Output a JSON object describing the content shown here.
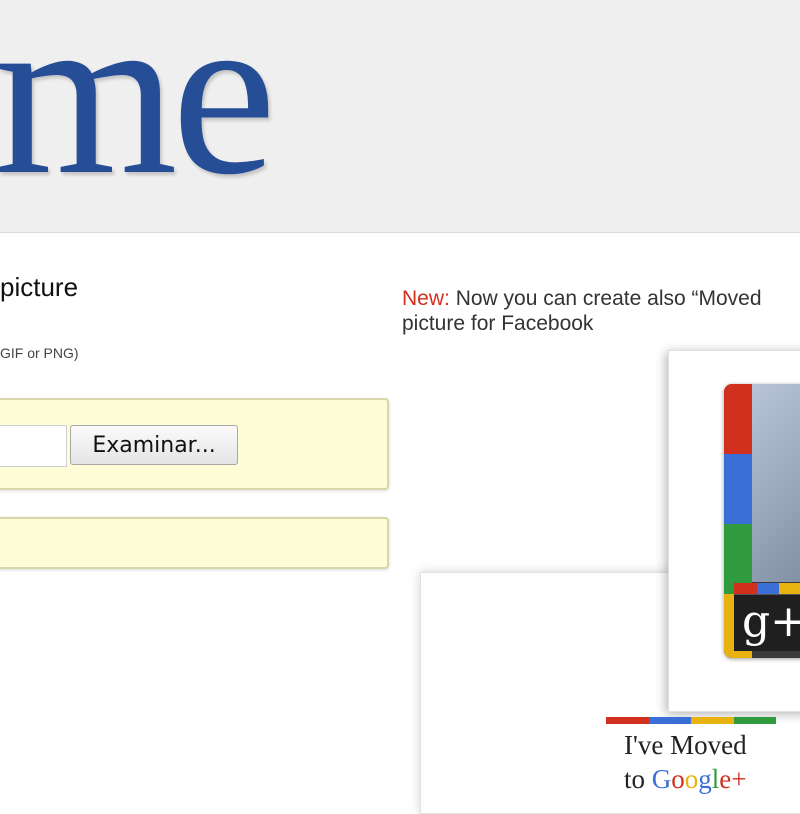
{
  "header": {
    "logo_text": "me"
  },
  "upload": {
    "heading": "picture",
    "format_hint": "GIF or PNG)",
    "browse_label": "Examinar..."
  },
  "news": {
    "label": "New:",
    "line1": "Now you can create also “Moved",
    "line2": "picture for Facebook"
  },
  "preview": {
    "moved_line1": "I've Moved",
    "moved_line2_prefix": "to ",
    "google_letters": [
      "G",
      "o",
      "o",
      "g",
      "l",
      "e"
    ],
    "google_plus": "+",
    "gplus_badge": "g+"
  },
  "colors": {
    "logo": "#264e96",
    "news_label": "#d2301f",
    "field_bg": "#fefdd8",
    "google_blue": "#3b6fd8",
    "google_red": "#d2301f",
    "google_yellow": "#e8b310",
    "google_green": "#2f9a3e"
  }
}
